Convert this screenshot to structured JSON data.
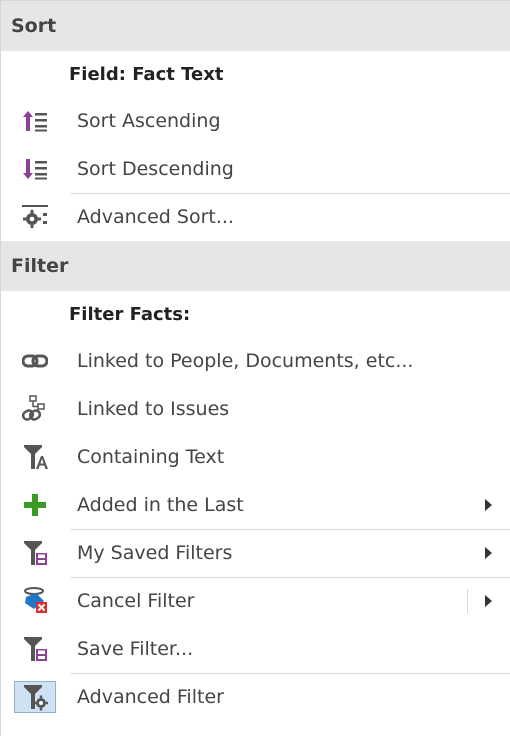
{
  "sort": {
    "header": "Sort",
    "field_label": "Field: Fact Text",
    "items": [
      {
        "label": "Sort Ascending",
        "icon": "sort-ascending-icon"
      },
      {
        "label": "Sort Descending",
        "icon": "sort-descending-icon"
      },
      {
        "label": "Advanced Sort...",
        "icon": "advanced-sort-icon"
      }
    ]
  },
  "filter": {
    "header": "Filter",
    "subheader": "Filter Facts:",
    "items": [
      {
        "label": "Linked to People, Documents, etc...",
        "icon": "link-icon"
      },
      {
        "label": "Linked to Issues",
        "icon": "link-issues-icon"
      },
      {
        "label": "Containing Text",
        "icon": "filter-text-icon"
      },
      {
        "label": "Added in the Last",
        "icon": "plus-icon"
      },
      {
        "label": "My Saved Filters",
        "icon": "saved-filter-icon"
      },
      {
        "label": "Cancel Filter",
        "icon": "cancel-filter-icon"
      },
      {
        "label": "Save Filter...",
        "icon": "save-filter-icon"
      },
      {
        "label": "Advanced Filter",
        "icon": "advanced-filter-icon"
      }
    ]
  },
  "colors": {
    "accent_purple": "#8e3f97",
    "accent_green": "#3a9b24",
    "accent_red": "#d9302c",
    "icon_gray": "#555555"
  }
}
